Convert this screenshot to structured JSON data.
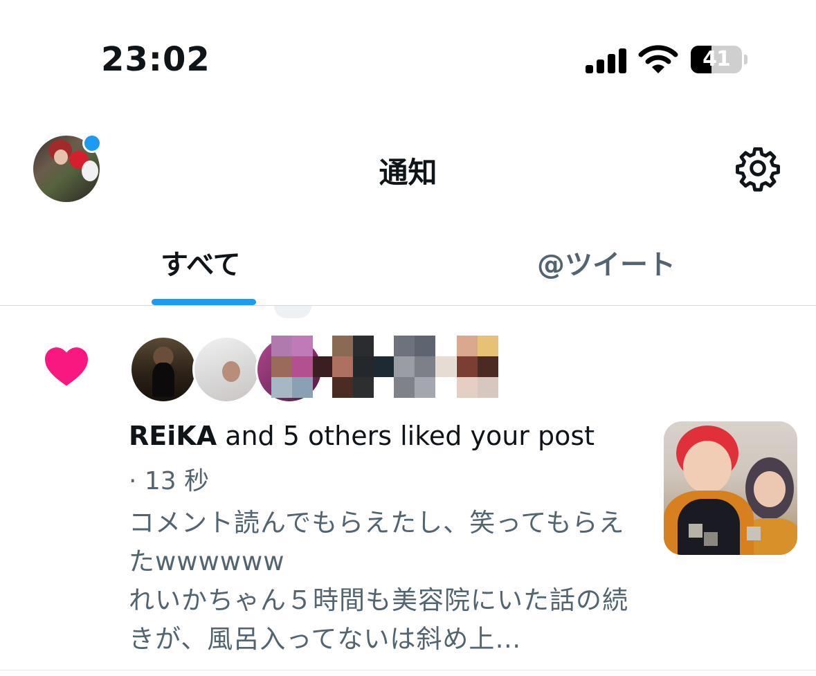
{
  "status_bar": {
    "time": "23:02",
    "battery": "41"
  },
  "header": {
    "title": "通知",
    "settings_icon": "gear-icon"
  },
  "tabs": [
    {
      "label": "すべて",
      "active": true
    },
    {
      "label": "@ツイート",
      "active": false
    }
  ],
  "colors": {
    "accent": "#1d9bf0",
    "like": "#f91880",
    "secondary_text": "#536471"
  },
  "notification": {
    "type_icon": "heart-icon",
    "actor": "REiKA",
    "action_text": " and 5 others liked your post",
    "meta": "· 13 秒",
    "post_text": "コメント読んでもらえたし、笑ってもらえたwwwwww\nれいかちゃん５時間も美容院にいた話の続きが、風呂入ってないは斜め上…"
  }
}
